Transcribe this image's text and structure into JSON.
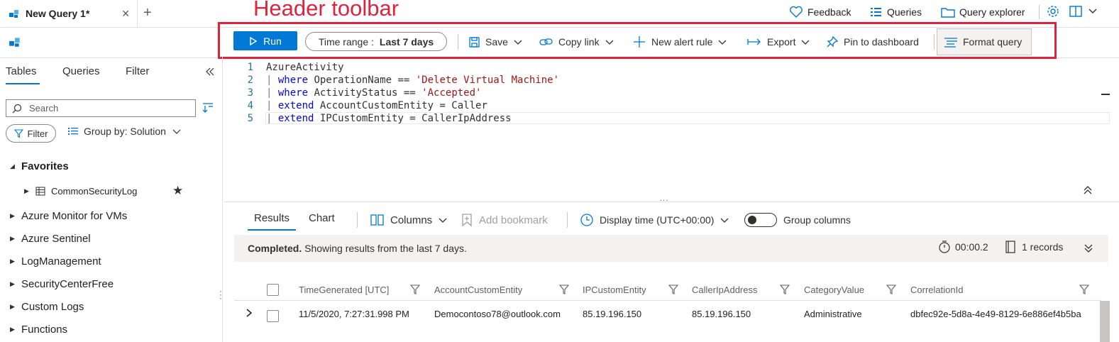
{
  "annotation": {
    "label": "Header toolbar",
    "color": "#e0233d"
  },
  "tab": {
    "title": "New Query 1*",
    "close": "✕",
    "new": "+"
  },
  "top_right": {
    "feedback": "Feedback",
    "queries": "Queries",
    "query_explorer": "Query explorer"
  },
  "toolbar": {
    "run": "Run",
    "time_range_label": "Time range :",
    "time_range_value": "Last 7 days",
    "save": "Save",
    "copy_link": "Copy link",
    "new_alert_rule": "New alert rule",
    "export": "Export",
    "pin": "Pin to dashboard",
    "format_query": "Format query"
  },
  "left_panel": {
    "tabs": [
      "Tables",
      "Queries",
      "Filter"
    ],
    "search_placeholder": "Search",
    "filter": "Filter",
    "group_by": "Group by: Solution",
    "favorites_header": "Favorites",
    "favorite_item": "CommonSecurityLog",
    "groups": [
      "Azure Monitor for VMs",
      "Azure Sentinel",
      "LogManagement",
      "SecurityCenterFree",
      "Custom Logs",
      "Functions"
    ]
  },
  "editor": {
    "line_numbers": [
      "1",
      "2",
      "3",
      "4",
      "5"
    ],
    "line1": "AzureActivity",
    "line2_kw": "where",
    "line2_mid": " OperationName == ",
    "line2_str": "'Delete Virtual Machine'",
    "line3_kw": "where",
    "line3_mid": " ActivityStatus == ",
    "line3_str": "'Accepted'",
    "line4_kw": "extend",
    "line4_rest": " AccountCustomEntity = Caller",
    "line5_kw": "extend",
    "line5_rest": " IPCustomEntity = CallerIpAddress",
    "pipe": "| ",
    "splitter": "..."
  },
  "results": {
    "tabs": [
      "Results",
      "Chart"
    ],
    "columns": "Columns",
    "add_bookmark": "Add bookmark",
    "display_time": "Display time (UTC+00:00)",
    "group_columns": "Group columns",
    "status_strong": "Completed.",
    "status_text": " Showing results from the last 7 days.",
    "duration": "00:00.2",
    "records": "1 records",
    "headers": [
      "TimeGenerated [UTC]",
      "AccountCustomEntity",
      "IPCustomEntity",
      "CallerIpAddress",
      "CategoryValue",
      "CorrelationId"
    ],
    "row": [
      "11/5/2020, 7:27:31.998 PM",
      "Democontoso78@outlook.com",
      "85.19.196.150",
      "85.19.196.150",
      "Administrative",
      "dbfec92e-5d8a-4e49-8129-6e886ef4b5ba"
    ]
  },
  "colors": {
    "accent": "#0078d4",
    "annotation": "#e0233d"
  }
}
